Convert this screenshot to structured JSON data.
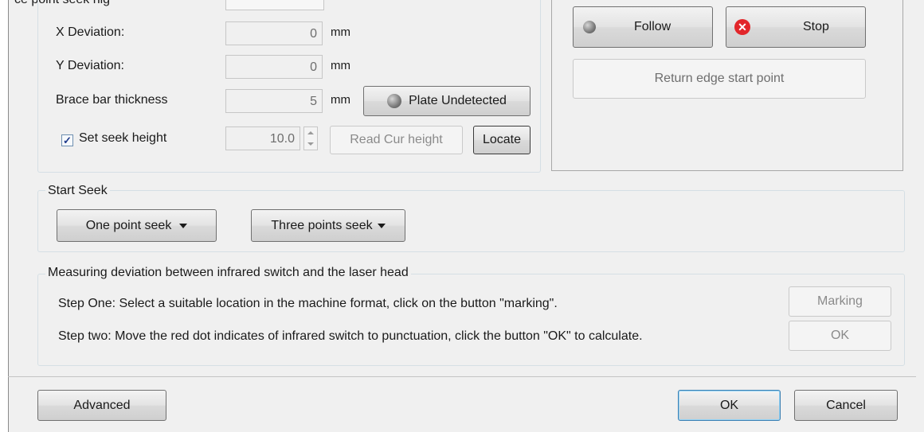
{
  "top": {
    "cut_label": "ce point seek hig"
  },
  "deviation": {
    "x_label": "X Deviation:",
    "x_value": "0",
    "x_unit": "mm",
    "y_label": "Y Deviation:",
    "y_value": "0",
    "y_unit": "mm",
    "brace_label": "Brace bar thickness",
    "brace_value": "5",
    "brace_unit": "mm",
    "plate_button": "Plate Undetected",
    "seek_height_checkbox": "Set seek height",
    "seek_height_checked": true,
    "seek_height_value": "10.0",
    "read_cur_height": "Read Cur height",
    "locate": "Locate"
  },
  "follow_panel": {
    "follow": "Follow",
    "stop": "Stop",
    "return_edge": "Return edge start point"
  },
  "start_seek": {
    "title": "Start Seek",
    "one_point": "One point seek",
    "three_points": "Three points seek"
  },
  "measuring": {
    "title": "Measuring deviation between infrared switch and the laser head",
    "step_one": "Step One: Select a suitable location in the machine format, click on the button \"marking\".",
    "step_two": "Step two: Move the red dot indicates of infrared switch to punctuation, click the button \"OK\" to calculate.",
    "marking": "Marking",
    "ok": "OK"
  },
  "footer": {
    "advanced": "Advanced",
    "ok": "OK",
    "cancel": "Cancel"
  },
  "icons": {
    "led": "gray-led-icon",
    "stop": "red-x-stop-icon"
  }
}
